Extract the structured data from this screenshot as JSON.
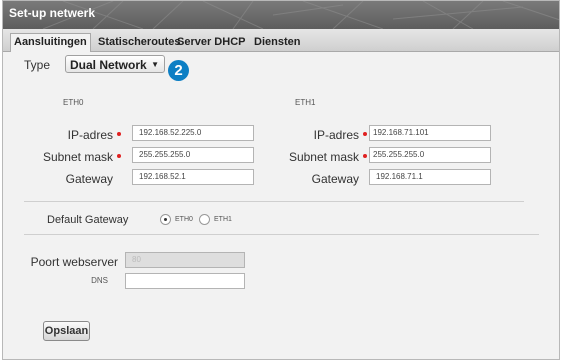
{
  "window": {
    "title": "Set-up netwerk"
  },
  "tabs": [
    {
      "label": "Aansluitingen",
      "active": true
    },
    {
      "label": "Statischeroutes",
      "active": false
    },
    {
      "label": "Server DHCP",
      "active": false
    },
    {
      "label": "Diensten",
      "active": false
    }
  ],
  "type_field": {
    "label": "Type",
    "value": "Dual Network",
    "arrow": "▼"
  },
  "step_badge": "2",
  "eth0": {
    "heading": "ETH0",
    "ip_label": "IP-adres",
    "ip_value": "192.168.52.225.0",
    "mask_label": "Subnet mask",
    "mask_value": "255.255.255.0",
    "gateway_label": "Gateway",
    "gateway_value": "192.168.52.1"
  },
  "eth1": {
    "heading": "ETH1",
    "ip_label": "IP-adres",
    "ip_value": "192.168.71.101",
    "mask_label": "Subnet mask",
    "mask_value": "255.255.255.0",
    "gateway_label": "Gateway",
    "gateway_value": "192.168.71.1"
  },
  "default_gateway": {
    "label": "Default Gateway",
    "options": [
      "ETH0",
      "ETH1"
    ],
    "selected": "ETH0"
  },
  "webserver": {
    "label": "Poort webserver",
    "value": "80"
  },
  "dns": {
    "label": "DNS",
    "value": ""
  },
  "save_button": "Opslaan",
  "colors": {
    "required": "#e02020",
    "badge": "#0d7fc4",
    "titlebar": "#6a6a6a"
  }
}
